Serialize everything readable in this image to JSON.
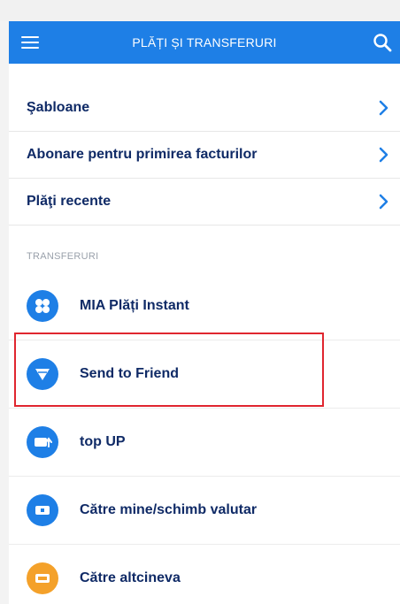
{
  "header": {
    "title": "PLĂȚI ȘI TRANSFERURI",
    "menu_icon": "hamburger-icon",
    "search_icon": "search-icon"
  },
  "menu_items": [
    {
      "label": "Şabloane"
    },
    {
      "label": "Abonare pentru primirea facturilor"
    },
    {
      "label": "Plăţi recente"
    }
  ],
  "transfers": {
    "section_label": "TRANSFERURI",
    "items": [
      {
        "label": "MIA Plăți Instant",
        "icon": "mia-instant-icon",
        "color": "#1e7fe6"
      },
      {
        "label": "Send to Friend",
        "icon": "send-to-friend-icon",
        "color": "#1e7fe6"
      },
      {
        "label": "top UP",
        "icon": "top-up-icon",
        "color": "#1e7fe6"
      },
      {
        "label": "Către mine/schimb valutar",
        "icon": "exchange-icon",
        "color": "#1e7fe6"
      },
      {
        "label": "Către altcineva",
        "icon": "transfer-other-icon",
        "color": "#f4a12a"
      }
    ]
  },
  "colors": {
    "accent": "#1e7fe6",
    "text": "#0f2a66",
    "highlight": "#e0262f"
  }
}
